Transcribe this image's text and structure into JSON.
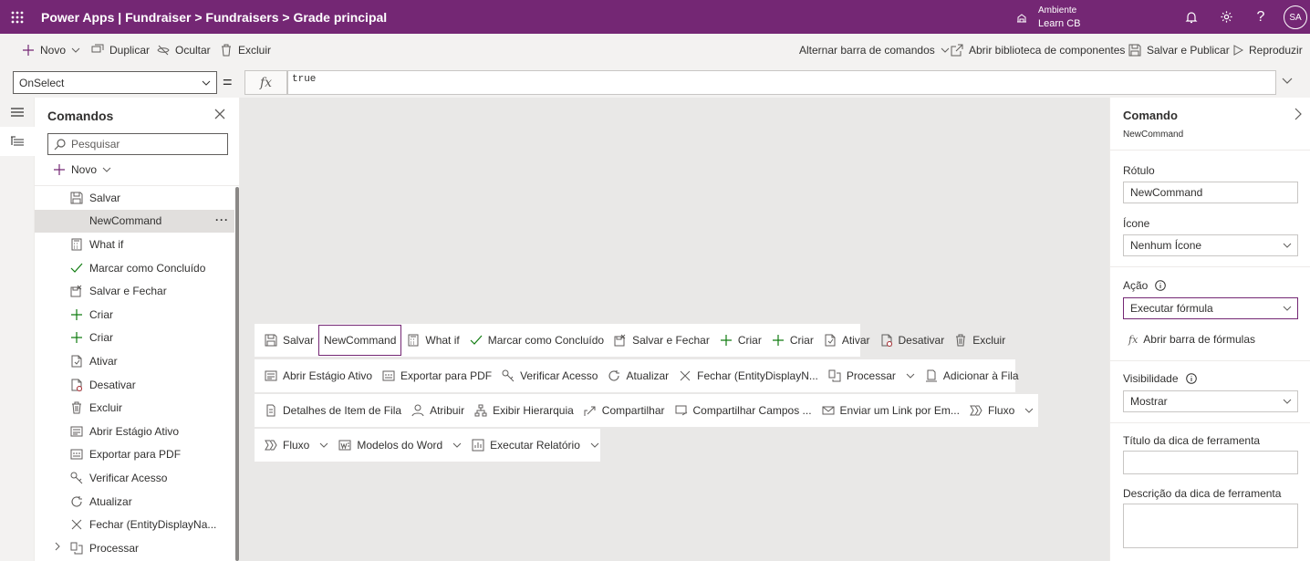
{
  "header": {
    "title": "Power Apps  |  Fundraiser > Fundraisers > Grade principal",
    "env_label": "Ambiente",
    "env_name": "Learn CB",
    "avatar": "SA",
    "color": "#742774"
  },
  "cmdbar": {
    "new": "Novo",
    "duplicate": "Duplicar",
    "hide": "Ocultar",
    "delete": "Excluir",
    "toggle_bar": "Alternar barra de comandos",
    "open_library": "Abrir biblioteca de componentes",
    "save_publish": "Salvar e Publicar",
    "play": "Reproduzir"
  },
  "formula": {
    "property": "OnSelect",
    "eq": "=",
    "fx": "fx",
    "value": "true"
  },
  "tree": {
    "title": "Comandos",
    "search_placeholder": "Pesquisar",
    "new": "Novo",
    "items": [
      {
        "label": "Salvar",
        "icon": "save-icon"
      },
      {
        "label": "NewCommand",
        "icon": "",
        "selected": true
      },
      {
        "label": "What if",
        "icon": "calculator-icon"
      },
      {
        "label": "Marcar como Concluído",
        "icon": "check-icon"
      },
      {
        "label": "Salvar e Fechar",
        "icon": "save-close-icon"
      },
      {
        "label": "Criar",
        "icon": "plus-icon"
      },
      {
        "label": "Criar",
        "icon": "plus-icon"
      },
      {
        "label": "Ativar",
        "icon": "page-icon"
      },
      {
        "label": "Desativar",
        "icon": "page-off-icon"
      },
      {
        "label": "Excluir",
        "icon": "trash-icon"
      },
      {
        "label": "Abrir Estágio Ativo",
        "icon": "stage-icon"
      },
      {
        "label": "Exportar para PDF",
        "icon": "pdf-icon"
      },
      {
        "label": "Verificar Acesso",
        "icon": "key-icon"
      },
      {
        "label": "Atualizar",
        "icon": "refresh-icon"
      },
      {
        "label": "Fechar (EntityDisplayNa...",
        "icon": "close-icon"
      },
      {
        "label": "Processar",
        "icon": "process-icon",
        "group": true
      }
    ]
  },
  "canvas": {
    "rows": [
      [
        "Salvar",
        "NewCommand",
        "What if",
        "Marcar como Concluído",
        "Salvar e Fechar",
        "Criar",
        "Criar",
        "Ativar",
        "Desativar",
        "Excluir"
      ],
      [
        "Abrir Estágio Ativo",
        "Exportar para PDF",
        "Verificar Acesso",
        "Atualizar",
        "Fechar (EntityDisplayN...",
        "Processar",
        "Adicionar à Fila"
      ],
      [
        "Detalhes de Item de Fila",
        "Atribuir",
        "Exibir Hierarquia",
        "Compartilhar",
        "Compartilhar Campos ...",
        "Enviar um Link por Em...",
        "Fluxo"
      ],
      [
        "Fluxo",
        "Modelos do Word",
        "Executar Relatório"
      ]
    ]
  },
  "panel": {
    "title": "Comando",
    "subtitle": "NewCommand",
    "label_title": "Rótulo",
    "label_value": "NewCommand",
    "icon_title": "Ícone",
    "icon_value": "Nenhum Ícone",
    "action_title": "Ação",
    "action_value": "Executar fórmula",
    "formula_link": "Abrir barra de fórmulas",
    "visibility_title": "Visibilidade",
    "visibility_value": "Mostrar",
    "tooltip_title_label": "Título da dica de ferramenta",
    "tooltip_desc_label": "Descrição da dica de ferramenta"
  }
}
